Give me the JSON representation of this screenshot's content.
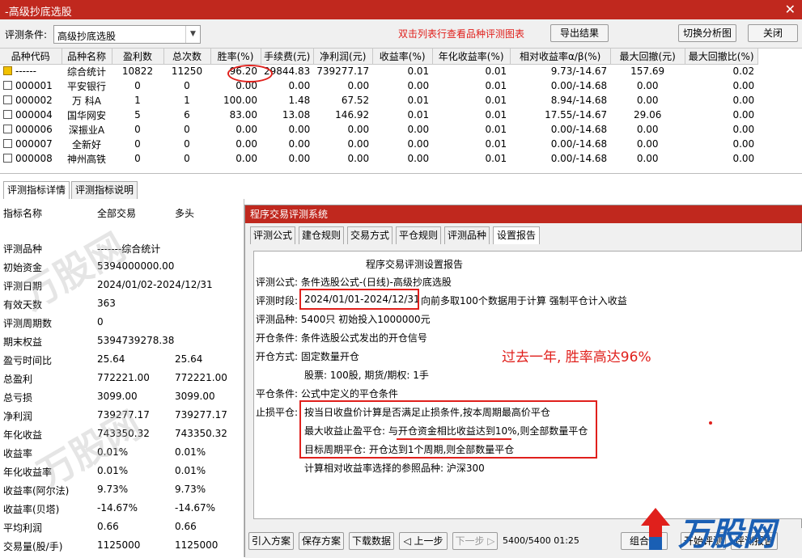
{
  "window": {
    "title": "-高级抄底选股",
    "close_glyph": "✕"
  },
  "toolbar": {
    "condition_label": "评测条件:",
    "condition_value": "高级抄底选股",
    "hint": "双击列表行查看品种评测图表",
    "export_label": "导出结果",
    "switch_label": "切换分析图",
    "close_label": "关闭"
  },
  "table": {
    "headers": [
      "品种代码",
      "品种名称",
      "盈利数",
      "总次数",
      "胜率(%)",
      "手续费(元)",
      "净利润(元)",
      "收益率(%)",
      "年化收益率(%)",
      "相对收益率α/β(%)",
      "最大回撤(元)",
      "最大回撤比(%)"
    ],
    "rows": [
      [
        "------",
        "综合统计",
        "10822",
        "11250",
        "96.20",
        "29844.83",
        "739277.17",
        "0.01",
        "0.01",
        "9.73/-14.67",
        "157.69",
        "0.02"
      ],
      [
        "000001",
        "平安银行",
        "0",
        "0",
        "0.00",
        "0.00",
        "0.00",
        "0.00",
        "0.01",
        "0.00/-14.68",
        "0.00",
        "0.00"
      ],
      [
        "000002",
        "万 科A",
        "1",
        "1",
        "100.00",
        "1.48",
        "67.52",
        "0.01",
        "0.01",
        "8.94/-14.68",
        "0.00",
        "0.00"
      ],
      [
        "000004",
        "国华网安",
        "5",
        "6",
        "83.00",
        "13.08",
        "146.92",
        "0.01",
        "0.01",
        "17.55/-14.67",
        "29.06",
        "0.00"
      ],
      [
        "000006",
        "深振业A",
        "0",
        "0",
        "0.00",
        "0.00",
        "0.00",
        "0.00",
        "0.01",
        "0.00/-14.68",
        "0.00",
        "0.00"
      ],
      [
        "000007",
        "全新好",
        "0",
        "0",
        "0.00",
        "0.00",
        "0.00",
        "0.00",
        "0.01",
        "0.00/-14.68",
        "0.00",
        "0.00"
      ],
      [
        "000008",
        "神州高铁",
        "0",
        "0",
        "0.00",
        "0.00",
        "0.00",
        "0.00",
        "0.01",
        "0.00/-14.68",
        "0.00",
        "0.00"
      ]
    ]
  },
  "lower_tabs": [
    "评测指标详情",
    "评测指标说明"
  ],
  "left_pane": {
    "header": [
      "指标名称",
      "全部交易",
      "多头"
    ],
    "rows": [
      {
        "k": "评测品种",
        "v1": "-------综合统计",
        "v2": ""
      },
      {
        "k": "初始资金",
        "v1": "5394000000.00",
        "v2": ""
      },
      {
        "k": "评测日期",
        "v1": "2024/01/02-2024/12/31",
        "v2": ""
      },
      {
        "k": "有效天数",
        "v1": "363",
        "v2": ""
      },
      {
        "k": "评测周期数",
        "v1": "0",
        "v2": ""
      },
      {
        "k": "期末权益",
        "v1": "5394739278.38",
        "v2": ""
      },
      {
        "k": "盈亏时间比",
        "v1": "25.64",
        "v2": "25.64"
      },
      {
        "k": "总盈利",
        "v1": "772221.00",
        "v2": "772221.00"
      },
      {
        "k": "总亏损",
        "v1": "3099.00",
        "v2": "3099.00"
      },
      {
        "k": "净利润",
        "v1": "739277.17",
        "v2": "739277.17"
      },
      {
        "k": "年化收益",
        "v1": "743350.32",
        "v2": "743350.32"
      },
      {
        "k": "收益率",
        "v1": "0.01%",
        "v2": "0.01%"
      },
      {
        "k": "年化收益率",
        "v1": "0.01%",
        "v2": "0.01%"
      },
      {
        "k": "收益率(阿尔法)",
        "v1": "9.73%",
        "v2": "9.73%"
      },
      {
        "k": "收益率(贝塔)",
        "v1": "-14.67%",
        "v2": "-14.67%"
      },
      {
        "k": "平均利润",
        "v1": "0.66",
        "v2": "0.66"
      },
      {
        "k": "交易量(股/手)",
        "v1": "1125000",
        "v2": "1125000"
      }
    ]
  },
  "dialog": {
    "title": "程序交易评测系统",
    "tabs": [
      "评测公式",
      "建仓规则",
      "交易方式",
      "平仓规则",
      "评测品种",
      "设置报告"
    ],
    "report": {
      "heading": "程序交易评测设置报告",
      "formula": "评测公式: 条件选股公式-(日线)-高级抄底选股",
      "period_label": "评测时段:",
      "period_value": "2024/01/01-2024/12/31",
      "period_rest": "向前多取100个数据用于计算 强制平仓计入收益",
      "varieties": "评测品种: 5400只 初始投入1000000元",
      "open_cond": "开仓条件: 条件选股公式发出的开仓信号",
      "open_mode": "开仓方式: 固定数量开仓",
      "lots": "股票: 100股, 期货/期权: 1手",
      "close_cond": "平仓条件: 公式中定义的平仓条件",
      "stop_label": "止损平仓:",
      "stop1": "按当日收盘价计算是否满足止损条件,按本周期最高价平仓",
      "stop2": "最大收益止盈平仓: 与开仓资金相比收益达到10%,则全部数量平仓",
      "stop3": "目标周期平仓: 开仓达到1个周期,则全部数量平仓",
      "benchmark": "计算相对收益率选择的参照品种: 沪深300"
    },
    "annotation": "过去一年, 胜率高达96%",
    "bottom_buttons": [
      "引入方案",
      "保存方案",
      "下载数据",
      "◁ 上一步",
      "下一步 ▷"
    ],
    "progress": "5400/5400  01:25",
    "right_buttons": [
      "组合测",
      "开始评测",
      "评测报告"
    ]
  },
  "brand": "万股网",
  "watermark": "万股网"
}
